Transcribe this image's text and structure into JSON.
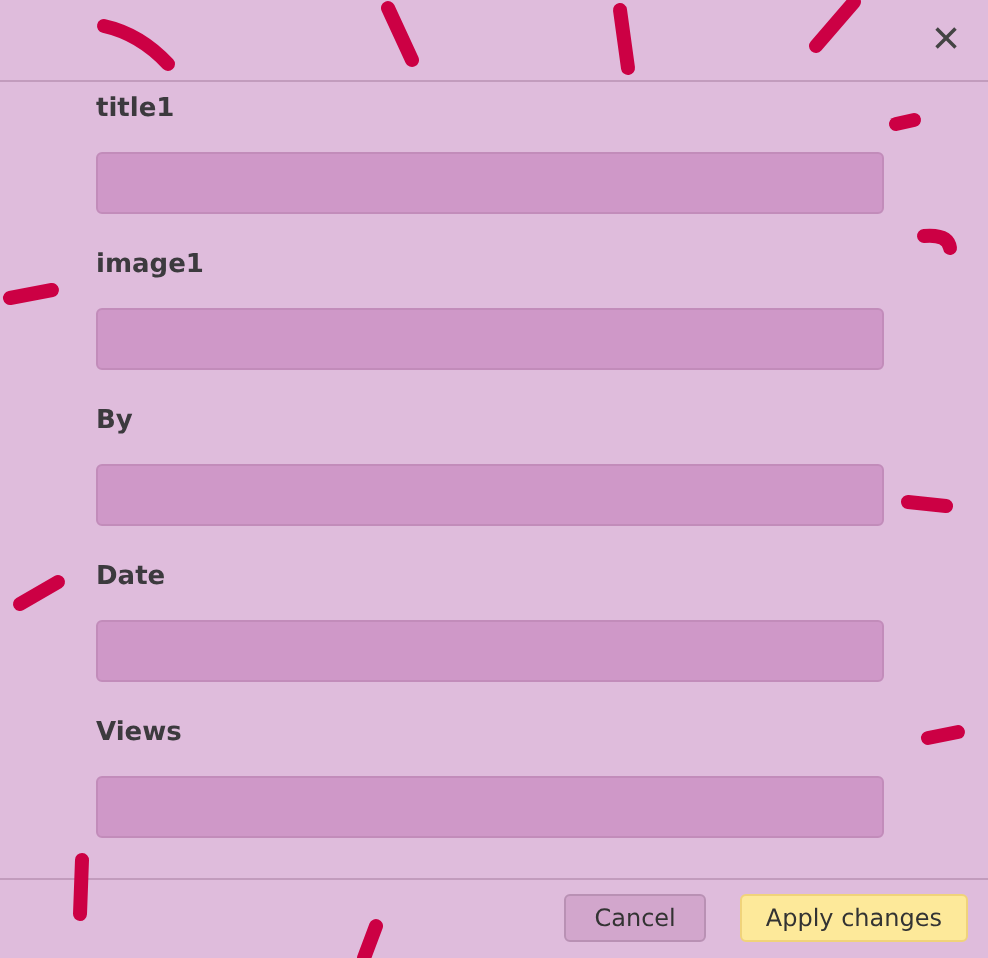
{
  "dialog": {
    "close": "×",
    "fields": [
      {
        "label": "title1"
      },
      {
        "label": "image1"
      },
      {
        "label": "By"
      },
      {
        "label": "Date"
      },
      {
        "label": "Views"
      }
    ],
    "buttons": [
      {
        "label": "Cancel",
        "kind": "secondary"
      },
      {
        "label": "Apply changes",
        "kind": "primary"
      }
    ]
  }
}
